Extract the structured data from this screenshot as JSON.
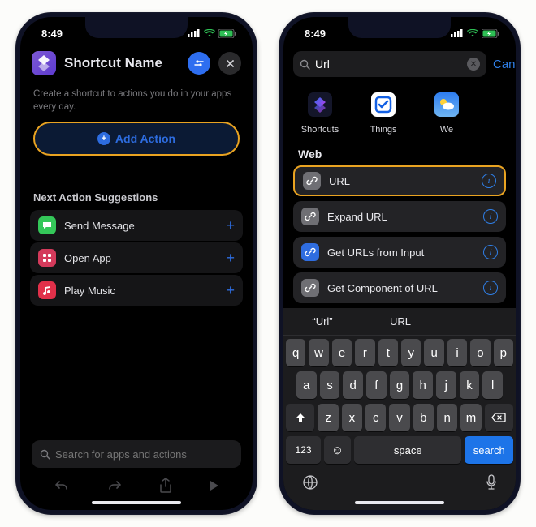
{
  "status": {
    "time": "8:49"
  },
  "left": {
    "header": {
      "title": "Shortcut Name"
    },
    "intro": "Create a shortcut to actions you do in your apps every day.",
    "add_action_label": "Add Action",
    "suggestions_header": "Next Action Suggestions",
    "suggestions": [
      {
        "label": "Send Message",
        "icon": "message-icon",
        "bg": "#34c759"
      },
      {
        "label": "Open App",
        "icon": "app-grid-icon",
        "bg": "#d43a5b"
      },
      {
        "label": "Play Music",
        "icon": "music-icon",
        "bg": "#e1304a"
      }
    ],
    "search_placeholder": "Search for apps and actions"
  },
  "right": {
    "search_value": "Url",
    "cancel_label": "Cancel",
    "chips": [
      {
        "label": "Shortcuts",
        "icon": "shortcuts-app-icon"
      },
      {
        "label": "Things",
        "icon": "things-app-icon"
      },
      {
        "label": "We",
        "icon": "weather-app-icon"
      }
    ],
    "group_header": "Web",
    "rows": [
      {
        "label": "URL",
        "icon": "link-icon",
        "bg": "#6f6f74",
        "highlight": true
      },
      {
        "label": "Expand URL",
        "icon": "link-icon",
        "bg": "#6f6f74",
        "highlight": false
      },
      {
        "label": "Get URLs from Input",
        "icon": "link-icon",
        "bg": "#2f6de0",
        "highlight": false
      },
      {
        "label": "Get Component of URL",
        "icon": "link-icon",
        "bg": "#6f6f74",
        "highlight": false
      }
    ],
    "predictions": [
      "“Url”",
      "URL"
    ],
    "keyboard": {
      "row1": [
        "q",
        "w",
        "e",
        "r",
        "t",
        "y",
        "u",
        "i",
        "o",
        "p"
      ],
      "row2": [
        "a",
        "s",
        "d",
        "f",
        "g",
        "h",
        "j",
        "k",
        "l"
      ],
      "row3": [
        "z",
        "x",
        "c",
        "v",
        "b",
        "n",
        "m"
      ],
      "mode_key": "123",
      "space_label": "space",
      "action_label": "search"
    }
  }
}
